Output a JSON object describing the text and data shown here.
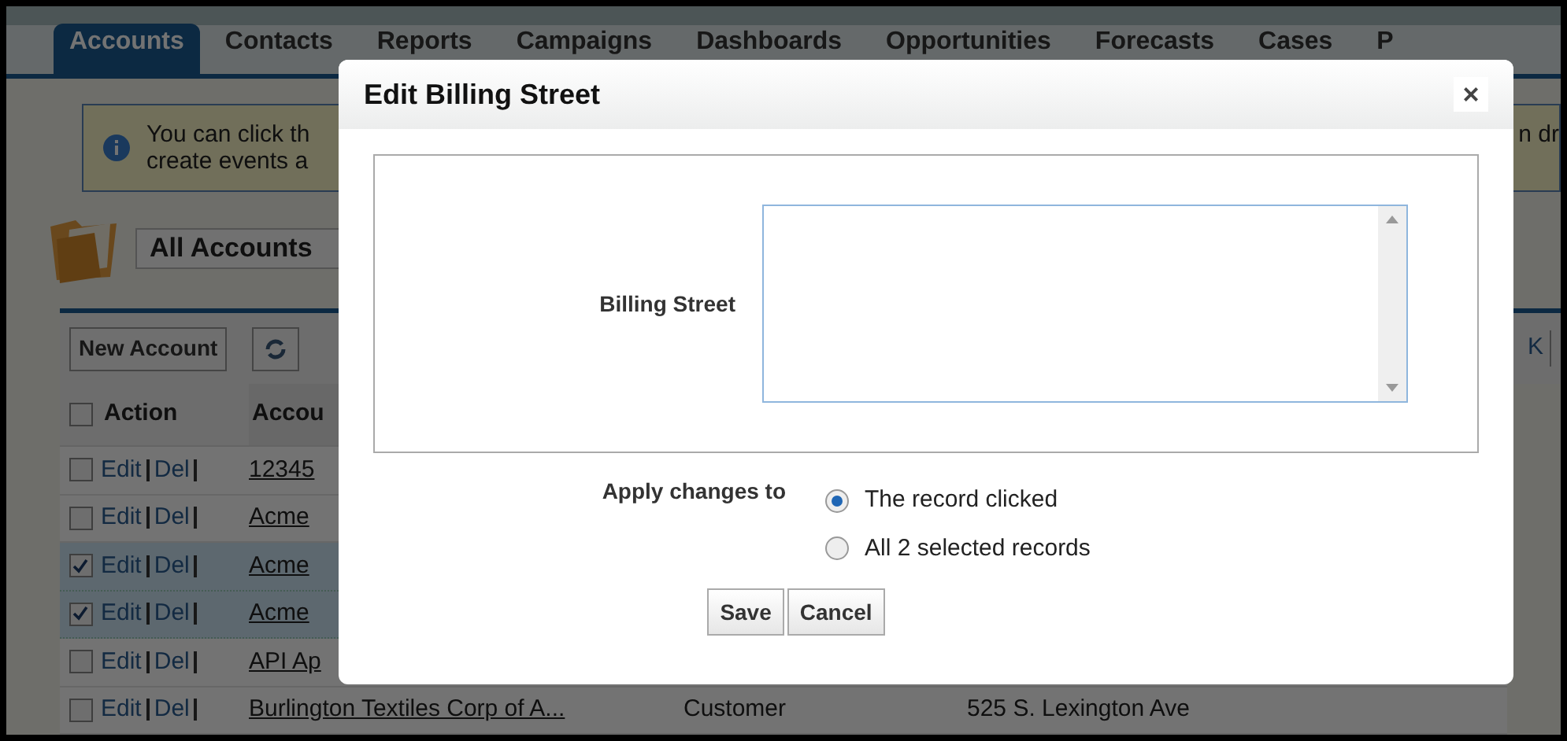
{
  "tabs": [
    {
      "label": "Accounts",
      "selected": true
    },
    {
      "label": "Contacts",
      "selected": false
    },
    {
      "label": "Reports",
      "selected": false
    },
    {
      "label": "Campaigns",
      "selected": false
    },
    {
      "label": "Dashboards",
      "selected": false
    },
    {
      "label": "Opportunities",
      "selected": false
    },
    {
      "label": "Forecasts",
      "selected": false
    },
    {
      "label": "Cases",
      "selected": false
    },
    {
      "label": "P",
      "selected": false
    }
  ],
  "banner": {
    "line1": "You can click th",
    "line2": "create events a",
    "right": "n dr"
  },
  "view": {
    "label": "All Accounts"
  },
  "toolbar": {
    "new_button": "New Account",
    "right_text": "K"
  },
  "table": {
    "select_all": {
      "checked": false
    },
    "action_header": "Action",
    "columns": [
      "Accou"
    ],
    "rows": [
      {
        "checked": false,
        "actions": [
          "Edit",
          "Del"
        ],
        "cells": [
          "12345"
        ]
      },
      {
        "checked": false,
        "actions": [
          "Edit",
          "Del"
        ],
        "cells": [
          "Acme"
        ]
      },
      {
        "checked": true,
        "actions": [
          "Edit",
          "Del"
        ],
        "cells": [
          "Acme"
        ]
      },
      {
        "checked": true,
        "actions": [
          "Edit",
          "Del"
        ],
        "cells": [
          "Acme"
        ]
      },
      {
        "checked": false,
        "actions": [
          "Edit",
          "Del"
        ],
        "cells": [
          "API Ap"
        ]
      },
      {
        "checked": false,
        "actions": [
          "Edit",
          "Del"
        ],
        "cells": [
          "Burlington Textiles Corp of A...",
          "Customer",
          "525 S. Lexington Ave"
        ]
      }
    ]
  },
  "dialog": {
    "title": "Edit Billing Street",
    "close": "×",
    "field_label": "Billing Street",
    "apply_label": "Apply changes to",
    "options": [
      {
        "label": "The record clicked",
        "selected": true
      },
      {
        "label": "All 2 selected records",
        "selected": false
      }
    ],
    "buttons": [
      "Save",
      "Cancel"
    ]
  }
}
